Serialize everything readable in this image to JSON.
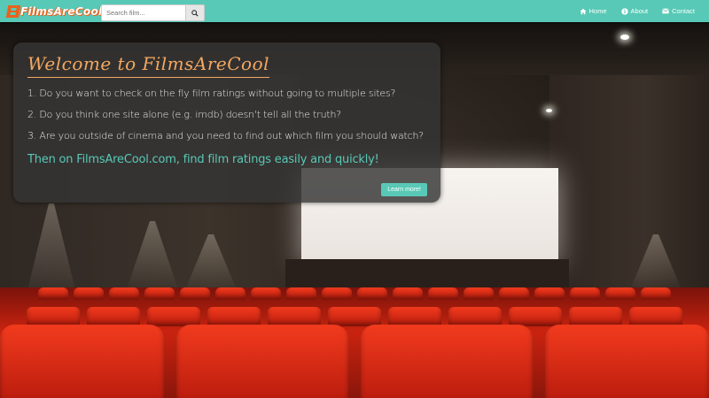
{
  "nav": {
    "logo_text": "FilmsAreCool",
    "search_placeholder": "Search film...",
    "links": [
      {
        "label": "Home",
        "icon": "home-icon"
      },
      {
        "label": "About",
        "icon": "info-icon"
      },
      {
        "label": "Contact",
        "icon": "envelope-icon"
      }
    ]
  },
  "hero": {
    "title": "Welcome to FilmsAreCool",
    "questions": [
      "1. Do you want to check on the fly film ratings without going to multiple sites?",
      "2. Do you think one site alone (e.g. imdb) doesn't tell all the truth?",
      "3. Are you outside of cinema and you need to find out which film you should watch?"
    ],
    "tagline": "Then on FilmsAreCool.com, find film ratings easily and quickly!",
    "cta_label": "Learn more!"
  },
  "colors": {
    "accent": "#58c9b6",
    "title": "#f4a760",
    "logo": "#e8621c"
  }
}
